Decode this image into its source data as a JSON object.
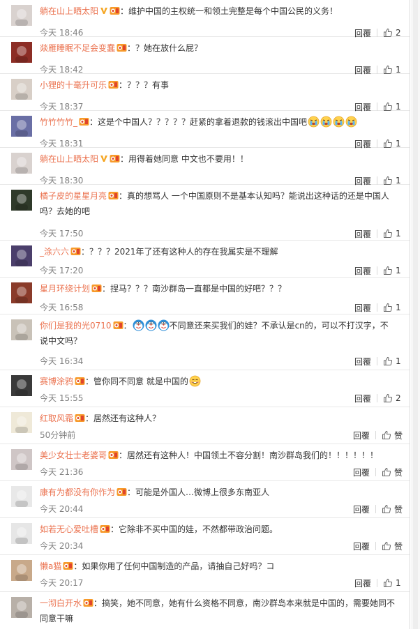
{
  "actions": {
    "reply_label": "回覆"
  },
  "comments": [
    {
      "user": "躺在山上晒太阳",
      "verified": true,
      "text": "：维护中国的主权统一和领土完整是每个中国公民的义务！",
      "emojis": [],
      "time": "今天 18:46",
      "likes": "2",
      "avatar_color": "#d9d2cf"
    },
    {
      "user": "燚雁睡眠不足会变蠢",
      "verified": false,
      "text": "：？她在放什么屁？",
      "emojis": [],
      "time": "今天 18:42",
      "likes": "1",
      "avatar_color": "#8c2d25"
    },
    {
      "user": "小狸的十毫升可乐",
      "verified": false,
      "text": "：？？？有事",
      "emojis": [],
      "time": "今天 18:37",
      "likes": "1",
      "avatar_color": "#d8cfc7"
    },
    {
      "user": "竹竹竹竹_",
      "verified": false,
      "text": "：这是个中国人？？？？？赶紧的拿着退款的钱滚出中国吧",
      "emojis": [
        "crying",
        "crying",
        "crying",
        "crying"
      ],
      "time": "今天 18:31",
      "likes": "1",
      "avatar_color": "#6a6fa5"
    },
    {
      "user": "躺在山上晒太阳",
      "verified": true,
      "text": "：用得着她同意 中文也不要用！！",
      "emojis": [],
      "time": "今天 18:30",
      "likes": "1",
      "avatar_color": "#d9d2cf"
    },
    {
      "user": "橘子皮的星星月亮",
      "verified": false,
      "text": "：真的想骂人 一个中国原则不是基本认知吗？能说出这种话的还是中国人吗？去她的吧",
      "emojis": [],
      "time": "今天 17:50",
      "likes": "1",
      "avatar_color": "#2f3a2a"
    },
    {
      "user": "_涂六六",
      "verified": false,
      "text": "：？？？2021年了还有这种人的存在我属实是不理解",
      "emojis": [],
      "time": "今天 17:20",
      "likes": "1",
      "avatar_color": "#4b3f6b"
    },
    {
      "user": "星月环绕计划",
      "verified": false,
      "text": "：捏马？？？南沙群岛一直都是中国的好吧？？？",
      "emojis": [],
      "time": "今天 16:58",
      "likes": "1",
      "avatar_color": "#8a3b2a"
    },
    {
      "user": "你们是我的光0710",
      "verified": false,
      "pre_emojis": [
        "doraemon",
        "doraemon",
        "doraemon"
      ],
      "text": "不同意还来买我们的娃？不承认是cn的，可以不打汉字，不说中文吗？",
      "emojis": [],
      "time": "今天 16:34",
      "likes": "1",
      "avatar_color": "#c9c2b8"
    },
    {
      "user": "赛博涂鸦",
      "verified": false,
      "text": "：管你同不同意 就是中国的",
      "emojis": [
        "smile"
      ],
      "time": "今天 15:55",
      "likes": "2",
      "avatar_color": "#3a3a3a"
    },
    {
      "user": "红取风霜",
      "verified": false,
      "text": "：居然还有这种人？",
      "emojis": [],
      "time": "50分钟前",
      "likes": "赞",
      "avatar_color": "#efe9d8"
    },
    {
      "user": "美少女壮士老婆哥",
      "verified": false,
      "text": "：居然还有这种人！中国领土不容分割！南沙群岛我们的！！！！！！",
      "emojis": [],
      "time": "今天 21:36",
      "likes": "赞",
      "avatar_color": "#cfc6c6"
    },
    {
      "user": "康有为都没有你作为",
      "verified": false,
      "text": "：可能是外国人…微博上很多东南亚人",
      "emojis": [],
      "time": "今天 20:44",
      "likes": "赞",
      "avatar_color": "#e8e8e8"
    },
    {
      "user": "如若无心爱吐槽",
      "verified": false,
      "text": "：它除非不买中国的娃，不然都带政治问题。",
      "emojis": [],
      "time": "今天 20:34",
      "likes": "赞",
      "avatar_color": "#e6e6e6"
    },
    {
      "user": "懒a猫",
      "verified": false,
      "text": "：如果你用了任何中国制造的产品，请抽自己好吗？コ",
      "emojis": [],
      "time": "今天 20:17",
      "likes": "1",
      "avatar_color": "#c8a98a"
    },
    {
      "user": "一沏白开水",
      "verified": false,
      "text": "：搞笑，她不同意，她有什么资格不同意，南沙群岛本来就是中国的，需要她同不同意干嘛",
      "emojis": [],
      "time": "",
      "likes": "",
      "avatar_color": "#b8b0a8"
    }
  ]
}
